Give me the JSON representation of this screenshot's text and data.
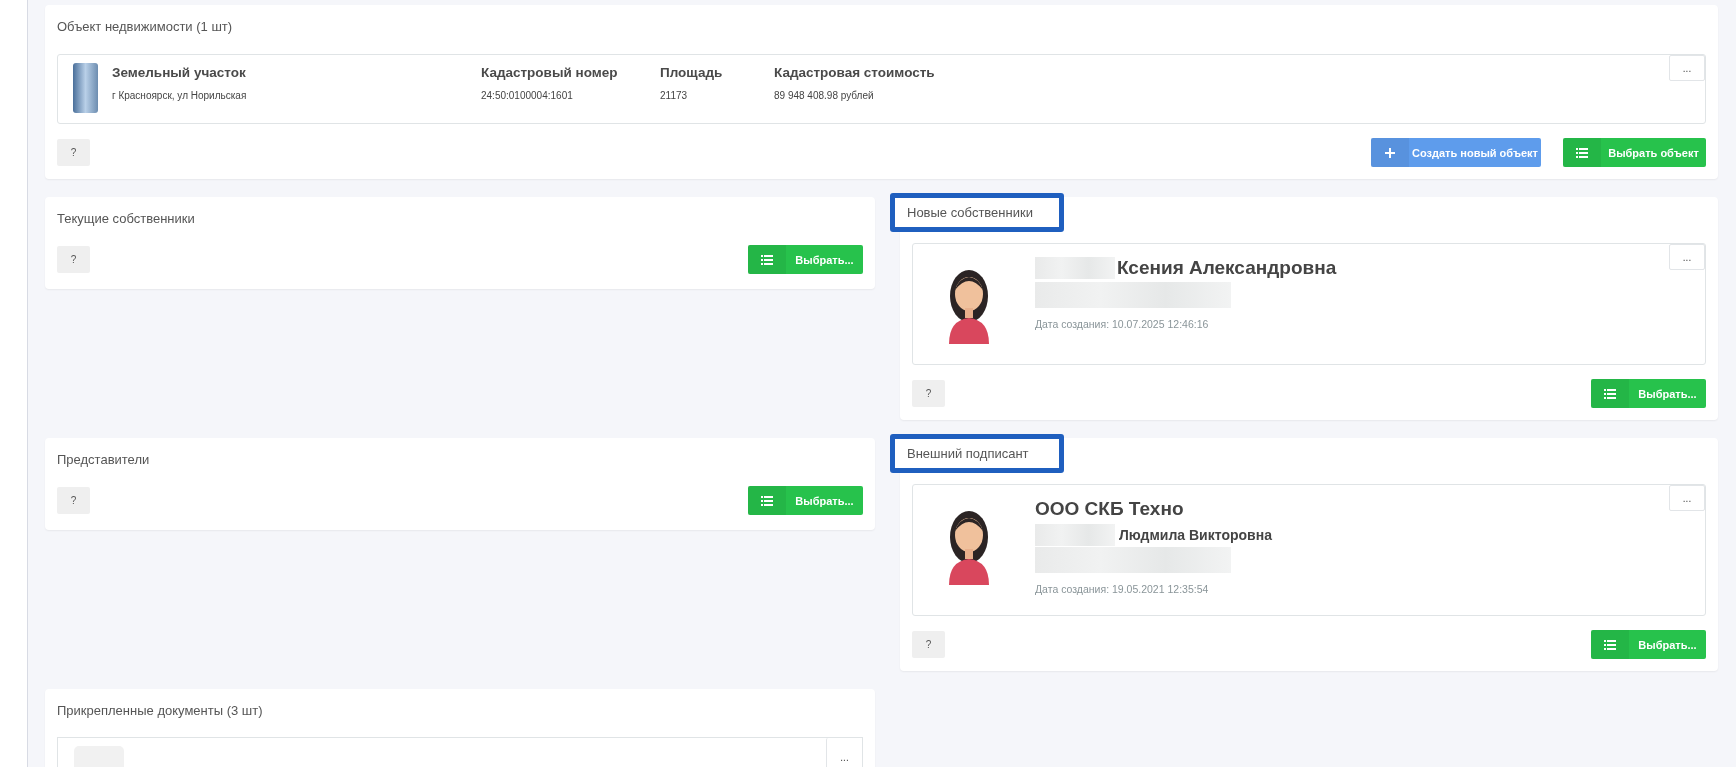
{
  "property_section": {
    "title": "Объект недвижимости (1 шт)",
    "object": {
      "name": "Земельный участок",
      "address": "г Красноярск, ул Норильская",
      "menu_button": "...",
      "fields": [
        {
          "label": "Кадастровый номер",
          "value": "24:50:0100004:1601"
        },
        {
          "label": "Площадь",
          "value": "21173"
        },
        {
          "label": "Кадастровая стоимость",
          "value": "89 948 408.98 рублей"
        }
      ]
    },
    "help_button": "?",
    "buttons": [
      {
        "kind": "create",
        "label": "Создать новый объект"
      },
      {
        "kind": "select",
        "label": "Выбрать объект"
      }
    ]
  },
  "rows": [
    {
      "sections": [
        {
          "title": "Текущие собственники",
          "highlighted": false,
          "help_button": "?",
          "select_button": "Выбрать..."
        },
        {
          "title": "Новые собственники",
          "highlighted": true,
          "help_button": "?",
          "select_button": "Выбрать...",
          "entries": [
            {
              "kind": "person",
              "menu_button": "...",
              "created": "Дата создания: 10.07.2025 12:46:16",
              "lines": [
                {
                  "kind": "heading",
                  "text": "Ксения Александровна",
                  "redacted_prefix": true
                },
                {
                  "kind": "redacted"
                }
              ]
            }
          ]
        }
      ]
    },
    {
      "sections": [
        {
          "title": "Представители",
          "highlighted": false,
          "help_button": "?",
          "select_button": "Выбрать..."
        },
        {
          "title": "Внешний подписант",
          "highlighted": true,
          "help_button": "?",
          "select_button": "Выбрать...",
          "entries": [
            {
              "kind": "person",
              "menu_button": "...",
              "created": "Дата создания: 19.05.2021 12:35:54",
              "lines": [
                {
                  "kind": "heading",
                  "text": "ООО СКБ Техно",
                  "redacted_prefix": false
                },
                {
                  "kind": "subheading",
                  "text": "Людмила Викторовна",
                  "redacted_prefix": true
                },
                {
                  "kind": "redacted"
                }
              ]
            }
          ]
        }
      ]
    },
    {
      "sections": [
        {
          "title": "Прикрепленные документы (3 шт)",
          "highlighted": false,
          "entries": [
            {
              "kind": "document",
              "menu_button": "..."
            }
          ]
        }
      ]
    }
  ]
}
